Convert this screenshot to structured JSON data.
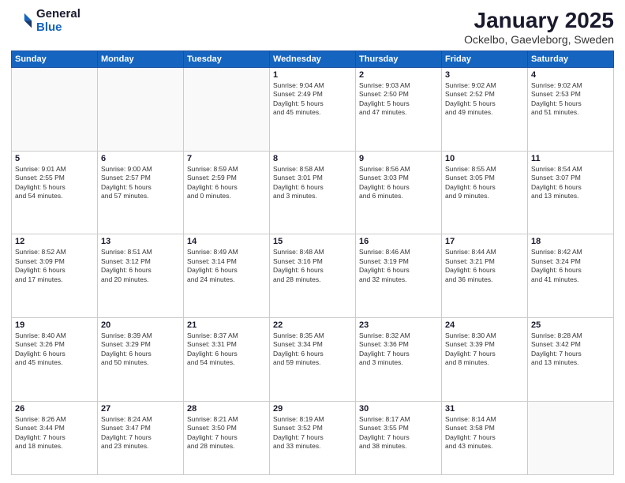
{
  "logo": {
    "general": "General",
    "blue": "Blue"
  },
  "title": "January 2025",
  "subtitle": "Ockelbo, Gaevleborg, Sweden",
  "weekdays": [
    "Sunday",
    "Monday",
    "Tuesday",
    "Wednesday",
    "Thursday",
    "Friday",
    "Saturday"
  ],
  "weeks": [
    [
      {
        "day": "",
        "info": ""
      },
      {
        "day": "",
        "info": ""
      },
      {
        "day": "",
        "info": ""
      },
      {
        "day": "1",
        "info": "Sunrise: 9:04 AM\nSunset: 2:49 PM\nDaylight: 5 hours\nand 45 minutes."
      },
      {
        "day": "2",
        "info": "Sunrise: 9:03 AM\nSunset: 2:50 PM\nDaylight: 5 hours\nand 47 minutes."
      },
      {
        "day": "3",
        "info": "Sunrise: 9:02 AM\nSunset: 2:52 PM\nDaylight: 5 hours\nand 49 minutes."
      },
      {
        "day": "4",
        "info": "Sunrise: 9:02 AM\nSunset: 2:53 PM\nDaylight: 5 hours\nand 51 minutes."
      }
    ],
    [
      {
        "day": "5",
        "info": "Sunrise: 9:01 AM\nSunset: 2:55 PM\nDaylight: 5 hours\nand 54 minutes."
      },
      {
        "day": "6",
        "info": "Sunrise: 9:00 AM\nSunset: 2:57 PM\nDaylight: 5 hours\nand 57 minutes."
      },
      {
        "day": "7",
        "info": "Sunrise: 8:59 AM\nSunset: 2:59 PM\nDaylight: 6 hours\nand 0 minutes."
      },
      {
        "day": "8",
        "info": "Sunrise: 8:58 AM\nSunset: 3:01 PM\nDaylight: 6 hours\nand 3 minutes."
      },
      {
        "day": "9",
        "info": "Sunrise: 8:56 AM\nSunset: 3:03 PM\nDaylight: 6 hours\nand 6 minutes."
      },
      {
        "day": "10",
        "info": "Sunrise: 8:55 AM\nSunset: 3:05 PM\nDaylight: 6 hours\nand 9 minutes."
      },
      {
        "day": "11",
        "info": "Sunrise: 8:54 AM\nSunset: 3:07 PM\nDaylight: 6 hours\nand 13 minutes."
      }
    ],
    [
      {
        "day": "12",
        "info": "Sunrise: 8:52 AM\nSunset: 3:09 PM\nDaylight: 6 hours\nand 17 minutes."
      },
      {
        "day": "13",
        "info": "Sunrise: 8:51 AM\nSunset: 3:12 PM\nDaylight: 6 hours\nand 20 minutes."
      },
      {
        "day": "14",
        "info": "Sunrise: 8:49 AM\nSunset: 3:14 PM\nDaylight: 6 hours\nand 24 minutes."
      },
      {
        "day": "15",
        "info": "Sunrise: 8:48 AM\nSunset: 3:16 PM\nDaylight: 6 hours\nand 28 minutes."
      },
      {
        "day": "16",
        "info": "Sunrise: 8:46 AM\nSunset: 3:19 PM\nDaylight: 6 hours\nand 32 minutes."
      },
      {
        "day": "17",
        "info": "Sunrise: 8:44 AM\nSunset: 3:21 PM\nDaylight: 6 hours\nand 36 minutes."
      },
      {
        "day": "18",
        "info": "Sunrise: 8:42 AM\nSunset: 3:24 PM\nDaylight: 6 hours\nand 41 minutes."
      }
    ],
    [
      {
        "day": "19",
        "info": "Sunrise: 8:40 AM\nSunset: 3:26 PM\nDaylight: 6 hours\nand 45 minutes."
      },
      {
        "day": "20",
        "info": "Sunrise: 8:39 AM\nSunset: 3:29 PM\nDaylight: 6 hours\nand 50 minutes."
      },
      {
        "day": "21",
        "info": "Sunrise: 8:37 AM\nSunset: 3:31 PM\nDaylight: 6 hours\nand 54 minutes."
      },
      {
        "day": "22",
        "info": "Sunrise: 8:35 AM\nSunset: 3:34 PM\nDaylight: 6 hours\nand 59 minutes."
      },
      {
        "day": "23",
        "info": "Sunrise: 8:32 AM\nSunset: 3:36 PM\nDaylight: 7 hours\nand 3 minutes."
      },
      {
        "day": "24",
        "info": "Sunrise: 8:30 AM\nSunset: 3:39 PM\nDaylight: 7 hours\nand 8 minutes."
      },
      {
        "day": "25",
        "info": "Sunrise: 8:28 AM\nSunset: 3:42 PM\nDaylight: 7 hours\nand 13 minutes."
      }
    ],
    [
      {
        "day": "26",
        "info": "Sunrise: 8:26 AM\nSunset: 3:44 PM\nDaylight: 7 hours\nand 18 minutes."
      },
      {
        "day": "27",
        "info": "Sunrise: 8:24 AM\nSunset: 3:47 PM\nDaylight: 7 hours\nand 23 minutes."
      },
      {
        "day": "28",
        "info": "Sunrise: 8:21 AM\nSunset: 3:50 PM\nDaylight: 7 hours\nand 28 minutes."
      },
      {
        "day": "29",
        "info": "Sunrise: 8:19 AM\nSunset: 3:52 PM\nDaylight: 7 hours\nand 33 minutes."
      },
      {
        "day": "30",
        "info": "Sunrise: 8:17 AM\nSunset: 3:55 PM\nDaylight: 7 hours\nand 38 minutes."
      },
      {
        "day": "31",
        "info": "Sunrise: 8:14 AM\nSunset: 3:58 PM\nDaylight: 7 hours\nand 43 minutes."
      },
      {
        "day": "",
        "info": ""
      }
    ]
  ]
}
